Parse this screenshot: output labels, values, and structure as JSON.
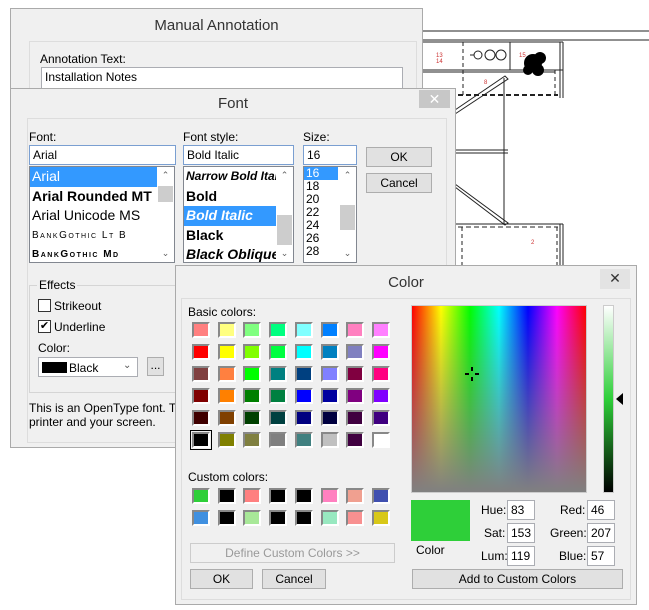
{
  "annotation_dialog": {
    "title": "Manual Annotation",
    "text_label": "Annotation Text:",
    "text_value": "Installation Notes"
  },
  "font_dialog": {
    "title": "Font",
    "close_icon": "close-icon",
    "font_label": "Font:",
    "font_value": "Arial",
    "fonts": [
      "Arial",
      "Arial Rounded MT",
      "Arial Unicode MS",
      "BankGothic Lt B",
      "BankGothic Md"
    ],
    "style_label": "Font style:",
    "style_value": "Bold Italic",
    "styles": [
      "Narrow Bold Italic",
      "Bold",
      "Bold Italic",
      "Black",
      "Black Oblique"
    ],
    "size_label": "Size:",
    "size_value": "16",
    "sizes": [
      "16",
      "18",
      "20",
      "22",
      "24",
      "26",
      "28"
    ],
    "ok": "OK",
    "cancel": "Cancel",
    "effects_label": "Effects",
    "strikeout": "Strikeout",
    "strikeout_checked": false,
    "underline": "Underline",
    "underline_checked": true,
    "color_label": "Color:",
    "color_value": "Black",
    "color_swatch": "#000000",
    "more_button": "...",
    "description": "This is an OpenType font. This",
    "description2": "printer and your screen."
  },
  "color_dialog": {
    "title": "Color",
    "basic_label": "Basic colors:",
    "custom_label": "Custom colors:",
    "basic_colors": [
      "#ff8080",
      "#ffff80",
      "#80ff80",
      "#00ff80",
      "#80ffff",
      "#0080ff",
      "#ff80c0",
      "#ff80ff",
      "#ff0000",
      "#ffff00",
      "#80ff00",
      "#00ff40",
      "#00ffff",
      "#0080c0",
      "#8080c0",
      "#ff00ff",
      "#804040",
      "#ff8040",
      "#00ff00",
      "#008080",
      "#004080",
      "#8080ff",
      "#800040",
      "#ff0080",
      "#800000",
      "#ff8000",
      "#008000",
      "#008040",
      "#0000ff",
      "#0000a0",
      "#800080",
      "#8000ff",
      "#400000",
      "#804000",
      "#004000",
      "#004040",
      "#000080",
      "#000040",
      "#400040",
      "#400080",
      "#000000",
      "#808000",
      "#808040",
      "#808080",
      "#408080",
      "#c0c0c0",
      "#400040",
      "#ffffff"
    ],
    "selected_basic_index": 40,
    "custom_colors": [
      "#2ecf39",
      "#000000",
      "#ff8080",
      "#000000",
      "#000000",
      "#ff80c0",
      "#f0a090",
      "#4050b0",
      "#4090e0",
      "#000000",
      "#a8e898",
      "#000000",
      "#000000",
      "#98e8c0",
      "#f89090",
      "#d8c818"
    ],
    "define_custom": "Define Custom Colors >>",
    "ok": "OK",
    "cancel": "Cancel",
    "preview_label": "Color",
    "current_color": "#2ecf39",
    "hue_label": "Hue:",
    "hue": "83",
    "sat_label": "Sat:",
    "sat": "153",
    "lum_label": "Lum:",
    "lum": "119",
    "red_label": "Red:",
    "red": "46",
    "green_label": "Green:",
    "green": "207",
    "blue_label": "Blue:",
    "blue": "57",
    "add_custom": "Add to Custom Colors"
  },
  "drawing": {
    "labels": [
      "13",
      "14",
      "15",
      "8",
      "2"
    ]
  }
}
